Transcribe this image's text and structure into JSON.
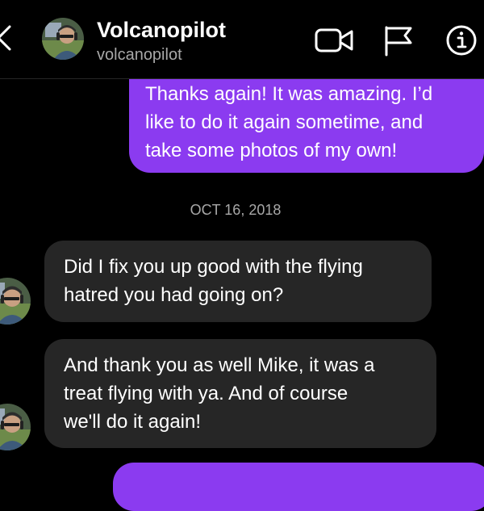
{
  "header": {
    "name": "Volcanopilot",
    "handle": "volcanopilot",
    "back_icon": "chevron-left-icon",
    "video_icon": "video-camera-icon",
    "flag_icon": "flag-icon",
    "info_icon": "info-icon"
  },
  "colors": {
    "sent_bubble": "#8b3bf0",
    "received_bubble": "#262626",
    "background": "#000000",
    "secondary_text": "#a8a8a8"
  },
  "thread": {
    "sent_1": {
      "lines": [
        "Thanks again! It was amazing. I’d",
        "like to do it again sometime, and",
        "take some photos of my own!"
      ]
    },
    "date_separator": "OCT 16, 2018",
    "received_1": {
      "lines": [
        "Did I fix you up good with the flying",
        "hatred you had going on?"
      ]
    },
    "received_2": {
      "lines": [
        "And thank you as well Mike, it was a",
        "treat flying with ya. And of course",
        "we'll do it again!"
      ]
    }
  }
}
